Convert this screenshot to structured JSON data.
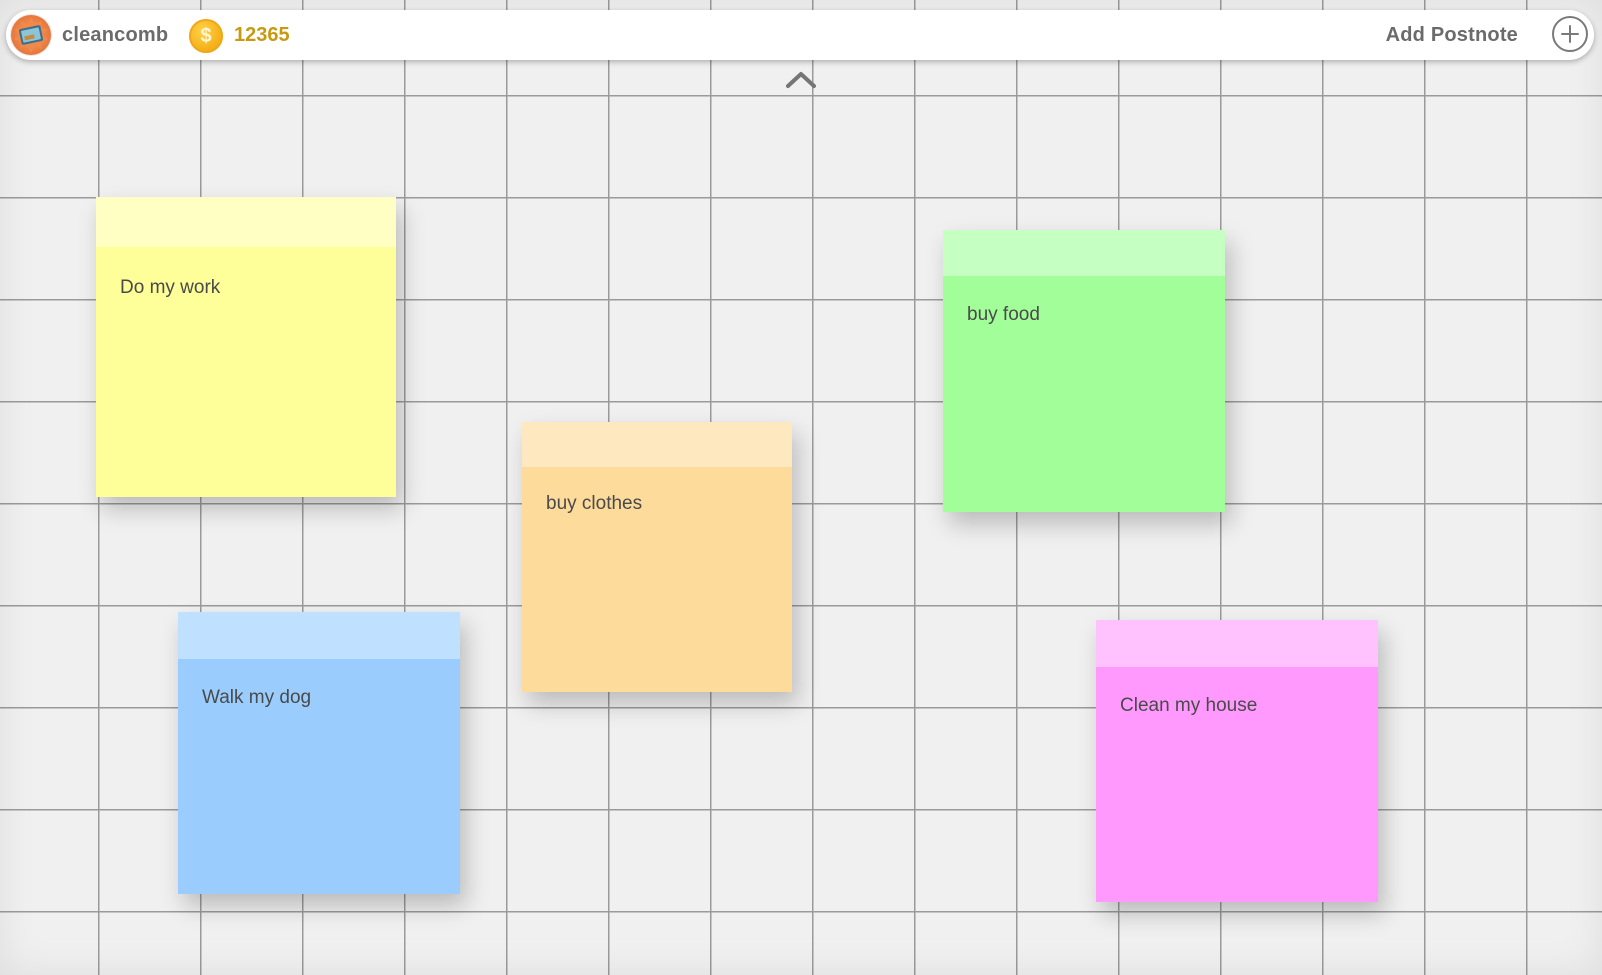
{
  "app": {
    "username": "cleancomb",
    "coins": "12365",
    "coin_symbol": "$",
    "add_label": "Add Postnote"
  },
  "icons": {
    "avatar": "avatar-icon",
    "coin": "coin-icon",
    "add": "plus-circle-icon",
    "collapse": "chevron-up-icon"
  },
  "notes": [
    {
      "text": "Do my work",
      "color": "#ffff99",
      "header_color": "#ffffc4"
    },
    {
      "text": "buy clothes",
      "color": "#fddb9a",
      "header_color": "#fde8c0"
    },
    {
      "text": "buy food",
      "color": "#a2fe98",
      "header_color": "#c6ffc2"
    },
    {
      "text": "Walk my dog",
      "color": "#9acdfe",
      "header_color": "#c0e0ff"
    },
    {
      "text": "Clean my house",
      "color": "#ff99fe",
      "header_color": "#ffc2ff"
    }
  ],
  "colors": {
    "board_background": "#f0f0f0",
    "grid_line": "#9a9a9a",
    "coin_text": "#c79a12",
    "label_text": "#6b6b6b"
  }
}
